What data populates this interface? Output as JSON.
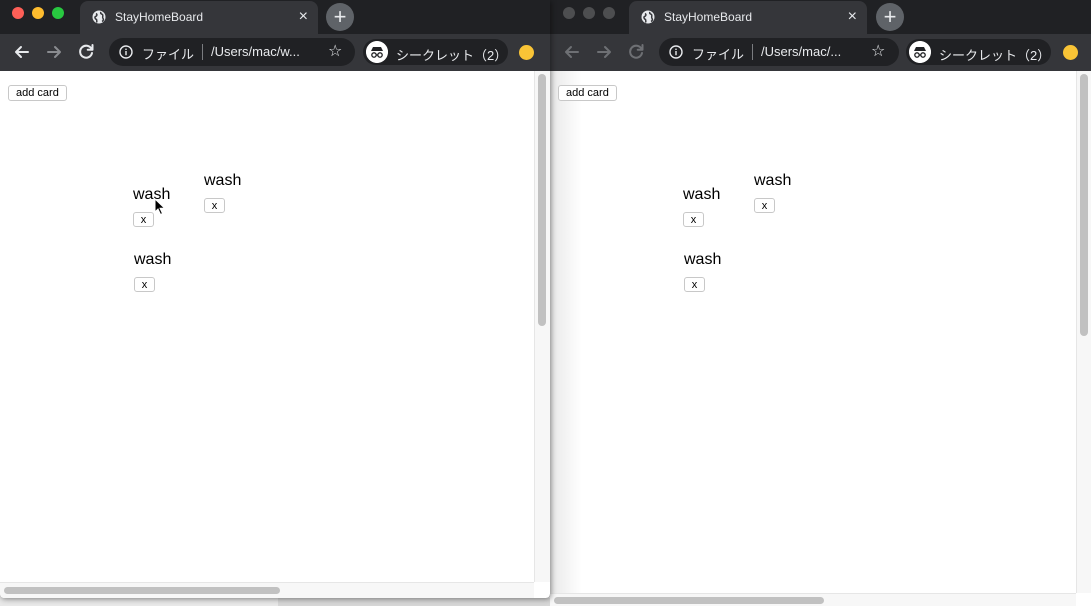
{
  "windows": [
    {
      "tab_title": "StayHomeBoard",
      "tab_close": "×",
      "new_tab": "+",
      "scheme": "ファイル",
      "url": "/Users/mac/w...",
      "incognito": "シークレット（2）",
      "add_card_label": "add card",
      "cards": [
        {
          "text": "wash",
          "close": "x"
        },
        {
          "text": "wash",
          "close": "x"
        },
        {
          "text": "wash",
          "close": "x"
        }
      ]
    },
    {
      "tab_title": "StayHomeBoard",
      "tab_close": "×",
      "new_tab": "+",
      "scheme": "ファイル",
      "url": "/Users/mac/...",
      "incognito": "シークレット（2）",
      "add_card_label": "add card",
      "cards": [
        {
          "text": "wash",
          "close": "x"
        },
        {
          "text": "wash",
          "close": "x"
        },
        {
          "text": "wash",
          "close": "x"
        }
      ]
    }
  ],
  "colors": {
    "tab_strip": "#202124",
    "toolbar": "#35363a",
    "text_light": "#e8eaed",
    "profile_badge": "#f9c436"
  },
  "icons": [
    "back-arrow-icon",
    "forward-arrow-icon",
    "reload-icon",
    "info-icon",
    "star-icon",
    "incognito-icon",
    "globe-icon",
    "close-icon",
    "plus-icon",
    "cursor-icon"
  ]
}
